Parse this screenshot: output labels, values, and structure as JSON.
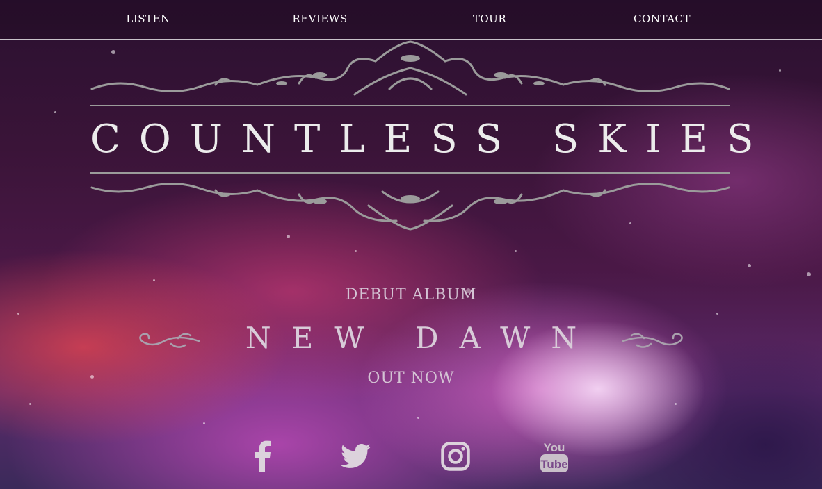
{
  "nav": {
    "items": [
      {
        "label": "LISTEN"
      },
      {
        "label": "REVIEWS"
      },
      {
        "label": "TOUR"
      },
      {
        "label": "CONTACT"
      }
    ]
  },
  "hero": {
    "band_name": "COUNTLESS SKIES",
    "debut_label": "DEBUT ALBUM",
    "album_title": "NEW DAWN",
    "release_status": "OUT NOW"
  },
  "social": [
    {
      "icon": "facebook-icon"
    },
    {
      "icon": "twitter-icon"
    },
    {
      "icon": "instagram-icon"
    },
    {
      "icon": "youtube-icon",
      "text": "You Tube"
    }
  ],
  "colors": {
    "ornament": "#9b9b9b",
    "title_text": "#ececec",
    "subtitle_text": "#d4c3d4"
  }
}
